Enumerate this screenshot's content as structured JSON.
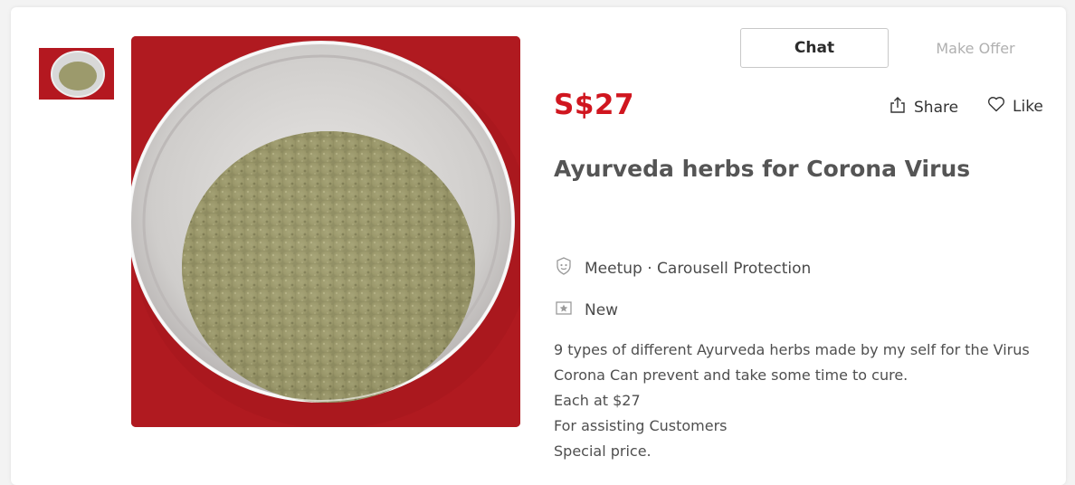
{
  "listing": {
    "price": "S$27",
    "title": "Ayurveda herbs for Corona Virus",
    "meetup_label": "Meetup · Carousell Protection",
    "condition_label": "New",
    "description_lines": [
      "9 types of different Ayurveda herbs made by my self for the Virus",
      "Corona Can prevent and take some time to cure.",
      "Each at $27",
      "For assisting Customers",
      "Special price."
    ]
  },
  "actions": {
    "chat_label": "Chat",
    "offer_label": "Make Offer",
    "share_label": "Share",
    "like_label": "Like"
  },
  "icons": {
    "share": "share-icon",
    "like": "heart-icon",
    "meetup": "shield-icon",
    "condition": "new-item-icon"
  },
  "colors": {
    "price": "#d0161f",
    "photo_background": "#b01a20"
  }
}
